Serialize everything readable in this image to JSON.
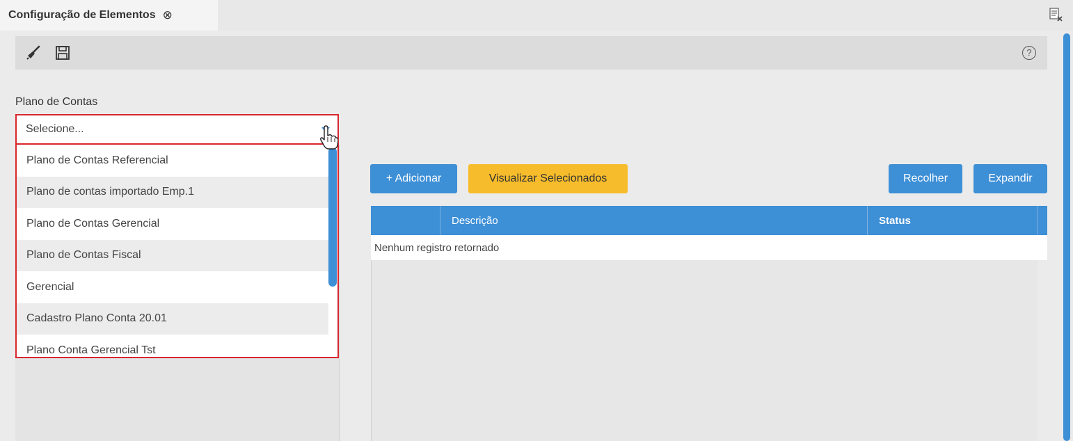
{
  "tab": {
    "title": "Configuração de Elementos",
    "close_icon": "⊗"
  },
  "toolbar": {
    "clear_icon": "broom-icon",
    "save_icon": "floppy-disk-icon",
    "help_symbol": "?"
  },
  "form": {
    "plano_label": "Plano de Contas",
    "plano_value": "Selecione..."
  },
  "dropdown": {
    "options": [
      "Plano de Contas Referencial",
      "Plano de contas importado Emp.1",
      "Plano de Contas Gerencial",
      "Plano de Contas Fiscal",
      "Gerencial",
      "Cadastro Plano Conta 20.01",
      "Plano Conta Gerencial Tst"
    ]
  },
  "buttons": {
    "add": "+ Adicionar",
    "view_selected": "Visualizar Selecionados",
    "collapse": "Recolher",
    "expand": "Expandir"
  },
  "table": {
    "columns": [
      "",
      "Descrição",
      "Status"
    ],
    "empty_message": "Nenhum registro retornado"
  },
  "colors": {
    "accent_blue": "#3d8fd6",
    "accent_yellow": "#f7bc2b",
    "error_red": "#d9262e"
  }
}
